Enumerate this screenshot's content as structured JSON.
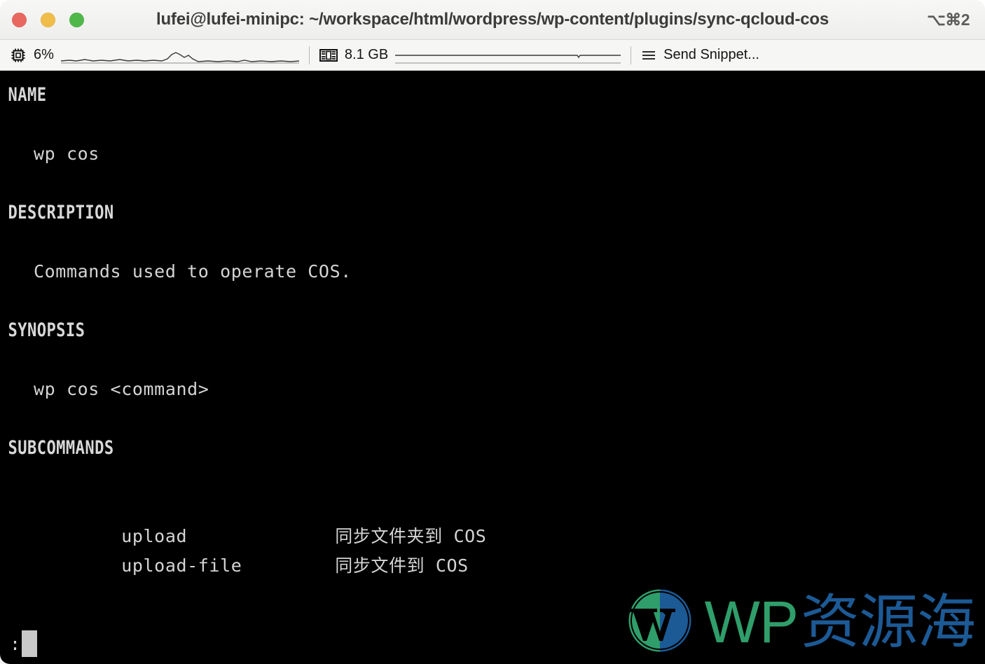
{
  "window": {
    "title": "lufei@lufei-minipc: ~/workspace/html/wordpress/wp-content/plugins/sync-qcloud-cos",
    "shortcut": "⌥⌘2",
    "controls": [
      {
        "name": "close",
        "color": "#e8685f"
      },
      {
        "name": "minimize",
        "color": "#f0bd4a"
      },
      {
        "name": "zoom",
        "color": "#50b84a"
      }
    ]
  },
  "toolbar": {
    "cpu": {
      "icon": "cpu-chip-icon",
      "value": "6%"
    },
    "memory": {
      "icon": "memory-stick-icon",
      "value": "8.1 GB"
    },
    "snippet": {
      "icon": "hamburger-menu-icon",
      "label": "Send Snippet..."
    }
  },
  "terminal": {
    "sections": [
      {
        "heading": "NAME",
        "lines": [
          {
            "cmd": "wp cos",
            "desc": ""
          }
        ]
      },
      {
        "heading": "DESCRIPTION",
        "lines": [
          {
            "cmd": "Commands used to operate COS.",
            "desc": ""
          }
        ]
      },
      {
        "heading": "SYNOPSIS",
        "lines": [
          {
            "cmd": "wp cos <command>",
            "desc": ""
          }
        ]
      },
      {
        "heading": "SUBCOMMANDS",
        "lines": [
          {
            "cmd": "upload",
            "desc": "同步文件夹到 COS"
          },
          {
            "cmd": "upload-file",
            "desc": "同步文件到 COS"
          }
        ]
      }
    ],
    "prompt": ":",
    "foreground": "#d4d4d4",
    "background": "#000000"
  },
  "watermark": {
    "logo": "wordpress-logo-icon",
    "latin": "WP",
    "chinese": "资源海",
    "latin_color": "#2f9e6b",
    "chinese_color": "#1c5a96"
  }
}
